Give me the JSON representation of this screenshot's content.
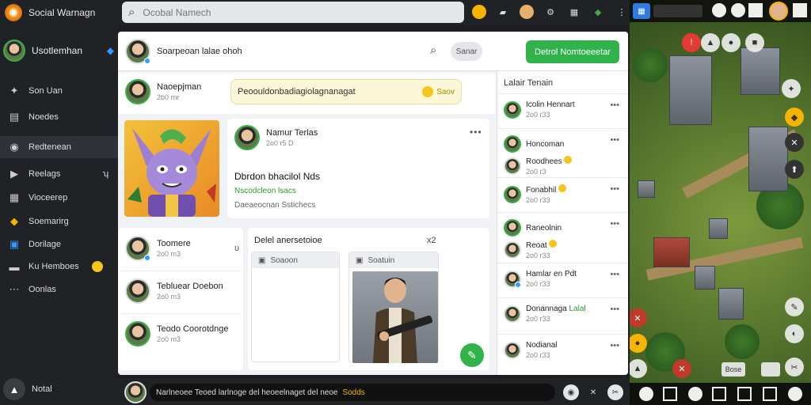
{
  "brand": {
    "name": "Social Warnagn"
  },
  "search": {
    "placeholder": "Ocobal Namech"
  },
  "sidebar": {
    "profile_name": "Usotlemhan",
    "items": [
      {
        "label": "Son Uan",
        "icon": "pin-icon",
        "glyph": "✦"
      },
      {
        "label": "Noedes",
        "icon": "note-icon",
        "glyph": "▤"
      },
      {
        "label": "Redtenean",
        "icon": "globe-icon",
        "glyph": "◉",
        "active": true
      },
      {
        "label": "Reelags",
        "icon": "video-icon",
        "glyph": "▶",
        "suffix": "ʮ"
      },
      {
        "label": "Vioceerep",
        "icon": "grid-icon",
        "glyph": "▦"
      },
      {
        "label": "Soemarirg",
        "icon": "game-icon",
        "glyph": "◆"
      },
      {
        "label": "Dorilage",
        "icon": "monitor-icon",
        "glyph": "▣"
      },
      {
        "label": "Ku Hemboes",
        "icon": "chat-icon",
        "glyph": "▬",
        "emoji": true
      },
      {
        "label": "Oonlas",
        "icon": "dots-icon",
        "glyph": "⋯"
      }
    ],
    "bottom_label": "Notal"
  },
  "header": {
    "user_name": "Soarpeoan lalae ohoh",
    "pill": "Sanar",
    "button": "Detrol Nomtoeeetar"
  },
  "composer": {
    "name": "Naoepjman",
    "sub": "2b0 rnr",
    "bubble_text": "Peoouldonbadiagiolagnanagat",
    "bubble_tag": "Saov"
  },
  "post": {
    "name": "Namur Terlas",
    "sub": "2o0 r5 D",
    "title": "Dbrdon bhacilol Nds",
    "link": "Nscodcleon lsacs",
    "meta": "Daeaeocnan Sstichecs"
  },
  "friends": [
    {
      "name": "Toomere",
      "sub": "2o0 m3",
      "trail": "υ"
    },
    {
      "name": "Tebluear Doebon",
      "sub": "2o0 m3",
      "trail": ""
    },
    {
      "name": "Teodo Coorotdnge",
      "sub": "2o0 m3",
      "trail": ""
    }
  ],
  "chat": {
    "title": "Delel anersetoioe",
    "close": "x2",
    "left_tab": "Soaoon",
    "right_tab": "Soatuin"
  },
  "right_column": {
    "title": "Lalair Tenain",
    "items": [
      {
        "name": "Icolin Hennart",
        "sub": "2o0 r33"
      },
      {
        "name": "Honcoman",
        "sub": "",
        "name2": "Roodhees",
        "sub2": "2o0 r3"
      },
      {
        "name": "Fonabhil",
        "sub": "2o0 r33"
      },
      {
        "name": "Raneolnin",
        "sub": "",
        "name2": "Reoat",
        "sub2": "2o0 r33"
      },
      {
        "name": "Hamlar en Pdt",
        "sub": "2o0 r33"
      },
      {
        "name": "Donannaga",
        "tag": "Lalal",
        "sub": "2o0 r33"
      },
      {
        "name": "Nodianal",
        "sub": "2o0 r33"
      }
    ]
  },
  "bottombar": {
    "text": "Narlneoee Teoed larlnoge del heoeelnaget del neoe",
    "tag": "Sodds"
  },
  "game": {
    "button_label": "Bose"
  }
}
